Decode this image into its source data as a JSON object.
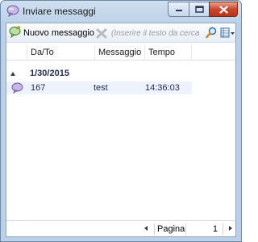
{
  "window": {
    "title": "Inviare messaggi"
  },
  "toolbar": {
    "new_message_label": "Nuovo messaggio",
    "search_placeholder": "(Inserire il testo da cerca"
  },
  "grid": {
    "columns": [
      "Da/To",
      "Messaggio",
      "Tempo"
    ],
    "groups": [
      {
        "label": "1/30/2015",
        "rows": [
          {
            "from_to": "167",
            "message": "test",
            "time": "14:36:03"
          }
        ]
      }
    ]
  },
  "pager": {
    "label": "Pagina",
    "page": "1"
  },
  "colors": {
    "title_bar": "#c4d7ec",
    "close_button": "#c9462c",
    "group_text": "#1e2a50",
    "row_highlight": "#eef3fb"
  },
  "icons": {
    "window": "speech-bubble-icon",
    "new_message": "new-message-icon",
    "delete": "delete-x-icon",
    "search": "magnifier-icon",
    "columns": "columns-menu-icon",
    "row": "speech-bubble-icon"
  }
}
